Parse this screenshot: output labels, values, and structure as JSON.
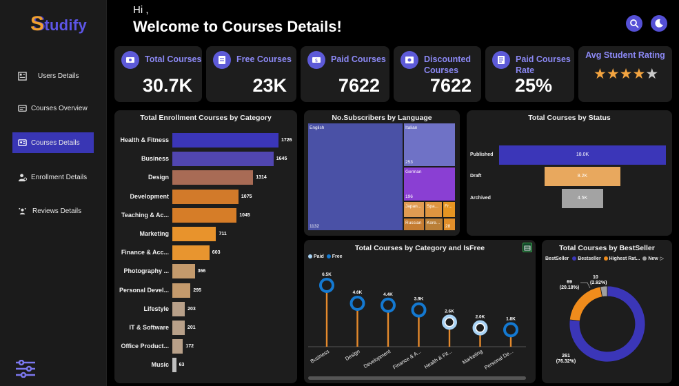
{
  "sidebar": {
    "logo_first": "S",
    "logo_rest": "tudify",
    "items": [
      {
        "label": "Users Details",
        "icon": "users-table-icon"
      },
      {
        "label": "Courses Overview",
        "icon": "courses-overview-icon"
      },
      {
        "label": "Courses Details",
        "icon": "courses-details-icon",
        "active": true
      },
      {
        "label": "Enrollment Details",
        "icon": "enrollment-icon"
      },
      {
        "label": "Reviews Details",
        "icon": "reviews-icon"
      }
    ]
  },
  "header": {
    "greeting": "Hi ,",
    "title": "Welcome to Courses Details!"
  },
  "kpis": [
    {
      "label": "Total Courses",
      "value": "30.7K",
      "icon": "courses-icon"
    },
    {
      "label": "Free Courses",
      "value": "23K",
      "icon": "free-icon"
    },
    {
      "label": "Paid Courses",
      "value": "7622",
      "icon": "paid-icon"
    },
    {
      "label_line1": "Discounted",
      "label_line2": "Courses",
      "value": "7622",
      "icon": "discount-icon"
    },
    {
      "label_line1": "Paid Courses",
      "label_line2": "Rate",
      "value": "25%",
      "icon": "rate-icon"
    }
  ],
  "rating": {
    "label": "Avg Student Rating",
    "stars_filled": 4,
    "stars_total": 5
  },
  "colors": {
    "accent": "#5d5ad8",
    "blue_bar": "#3b36b8",
    "orange": "#e58a2c",
    "brown": "#a86b55",
    "tan": "#c49a6c",
    "treemap_main": "#4a51a6",
    "purple": "#8c3fd4",
    "light_blue": "#a9d3f5",
    "ring_blue": "#1479d1"
  },
  "chart_data": [
    {
      "type": "bar",
      "orientation": "horizontal",
      "title": "Total Enrollment Courses by Category",
      "categories": [
        "Health & Fitness",
        "Business",
        "Design",
        "Development",
        "Teaching & Ac...",
        "Marketing",
        "Finance & Acc...",
        "Photography ...",
        "Personal Devel...",
        "Lifestyle",
        "IT & Software",
        "Office Product...",
        "Music"
      ],
      "values": [
        1726,
        1645,
        1314,
        1075,
        1045,
        711,
        603,
        366,
        295,
        203,
        201,
        172,
        63
      ],
      "colors": [
        "#3b36b8",
        "#5146b0",
        "#a86b55",
        "#d27a2a",
        "#d67d28",
        "#e8932c",
        "#e8952f",
        "#c49a6c",
        "#c49a6c",
        "#b8a089",
        "#b8a089",
        "#b8a089",
        "#bfbfbf"
      ]
    },
    {
      "type": "treemap",
      "title": "No.Subscribers by Language",
      "cells": [
        {
          "label": "English",
          "value": 1132,
          "color": "#4a51a6"
        },
        {
          "label": "Italian",
          "value": 253,
          "color": "#6f72c6"
        },
        {
          "label": "German",
          "value": 196,
          "color": "#8a3fd3"
        },
        {
          "label": "Japan...",
          "color": "#e09b52"
        },
        {
          "label": "Spa...",
          "color": "#df9540"
        },
        {
          "label": "Fr...",
          "color": "#e69522"
        },
        {
          "label": "Russian",
          "color": "#c57c32"
        },
        {
          "label": "Kore...",
          "color": "#ba7f37"
        },
        {
          "label": "",
          "value": 28,
          "color": "#e18e2a"
        }
      ]
    },
    {
      "type": "bar",
      "orientation": "horizontal-funnel",
      "title": "Total Courses by Status",
      "categories": [
        "Published",
        "Draft",
        "Archived"
      ],
      "values": [
        18000,
        8200,
        4500
      ],
      "labels": [
        "18.0K",
        "8.2K",
        "4.5K"
      ],
      "colors": [
        "#3b36b8",
        "#e8a85e",
        "#a3a3a3"
      ]
    },
    {
      "type": "scatter",
      "title": "Total Courses by Category and IsFree",
      "legend": [
        "Paid",
        "Free"
      ],
      "categories": [
        "Business",
        "Design",
        "Development",
        "Finance & A...",
        "Health & Fit...",
        "Marketing",
        "Personal De..."
      ],
      "values": [
        6500,
        4600,
        4400,
        3900,
        2600,
        2000,
        1800
      ],
      "labels": [
        "6.5K",
        "4.6K",
        "4.4K",
        "3.9K",
        "2.6K",
        "2.0K",
        "1.8K"
      ],
      "ring_style": [
        "blue",
        "blue",
        "blue",
        "blue",
        "light",
        "light",
        "blue"
      ],
      "ymax": 7500
    },
    {
      "type": "pie",
      "title": "Total Courses by BestSeller",
      "legend_title": "BestSeller",
      "legend": [
        {
          "label": "Bestseller",
          "color": "#3b36b8"
        },
        {
          "label": "Highest Rat...",
          "color": "#f08c1c"
        },
        {
          "label": "New",
          "color": "#a0a0a0"
        }
      ],
      "values": [
        261,
        69,
        10
      ],
      "slice_labels": [
        {
          "count": "261",
          "pct": "(76.32%)"
        },
        {
          "count": "69",
          "pct": "(20.18%)"
        },
        {
          "count": "10",
          "pct": "(2.92%)"
        }
      ]
    }
  ]
}
